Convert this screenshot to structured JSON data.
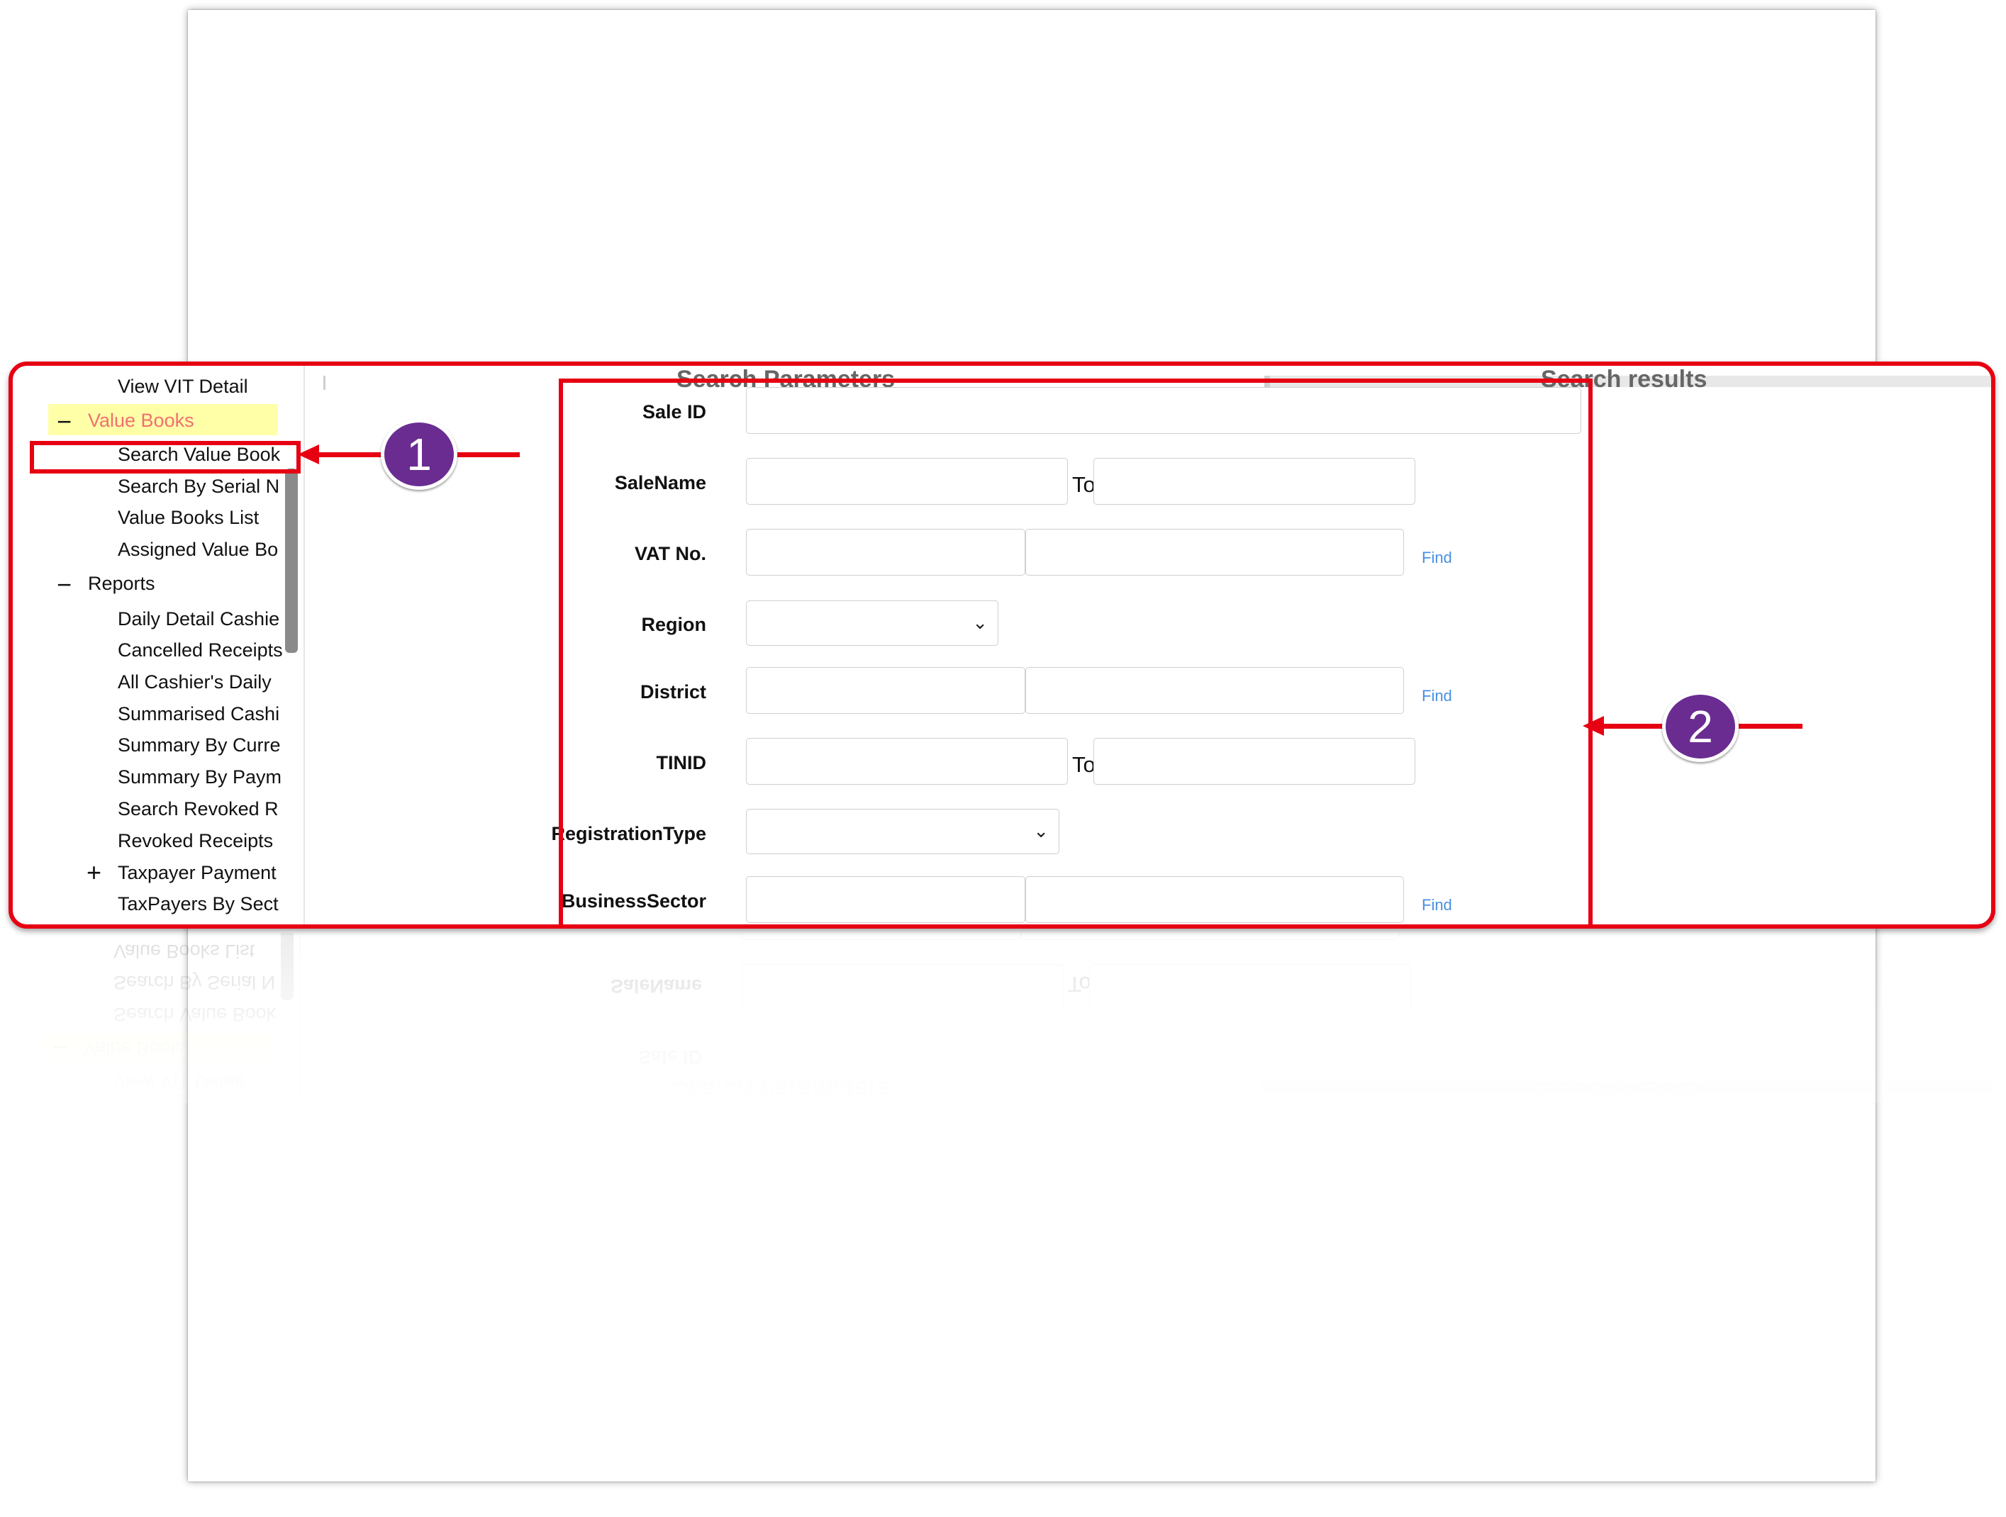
{
  "sidebar": {
    "items": [
      {
        "label": "View VIT Detail"
      },
      {
        "label": "Value Books",
        "sign": "−"
      },
      {
        "label": "Search Value Book"
      },
      {
        "label": "Search By Serial N"
      },
      {
        "label": "Value Books List"
      },
      {
        "label": "Assigned Value Bo"
      },
      {
        "label": "Reports",
        "sign": "−"
      },
      {
        "label": "Daily Detail Cashie"
      },
      {
        "label": "Cancelled Receipts"
      },
      {
        "label": "All Cashier's Daily"
      },
      {
        "label": "Summarised Cashi"
      },
      {
        "label": "Summary By Curre"
      },
      {
        "label": "Summary By Paym"
      },
      {
        "label": "Search Revoked R"
      },
      {
        "label": "Revoked Receipts"
      },
      {
        "label": "Taxpayer Payment",
        "sign": "+"
      },
      {
        "label": "TaxPayers By Sect"
      }
    ]
  },
  "search_parameters": {
    "title": "Search Parameters",
    "fields": {
      "sale_id": {
        "label": "Sale ID",
        "value": ""
      },
      "sale_name": {
        "label": "SaleName",
        "from": "",
        "to_label": "To",
        "to": ""
      },
      "vat_no": {
        "label": "VAT No.",
        "code": "",
        "name": "",
        "find": "Find"
      },
      "region": {
        "label": "Region",
        "selected": ""
      },
      "district": {
        "label": "District",
        "code": "",
        "name": "",
        "find": "Find"
      },
      "tinid": {
        "label": "TINID",
        "from": "",
        "to_label": "To",
        "to": ""
      },
      "registration_type": {
        "label": "RegistrationType",
        "selected": ""
      },
      "business_sector": {
        "label": "BusinessSector",
        "code": "",
        "name": "",
        "find": "Find"
      }
    }
  },
  "search_results": {
    "title": "Search results"
  },
  "callouts": [
    {
      "number": "1"
    },
    {
      "number": "2"
    }
  ],
  "colors": {
    "annotation_red": "#e60012",
    "badge_purple": "#6a2c91",
    "highlight_yellow": "#ffffa8",
    "link_blue": "#4a90e2"
  }
}
